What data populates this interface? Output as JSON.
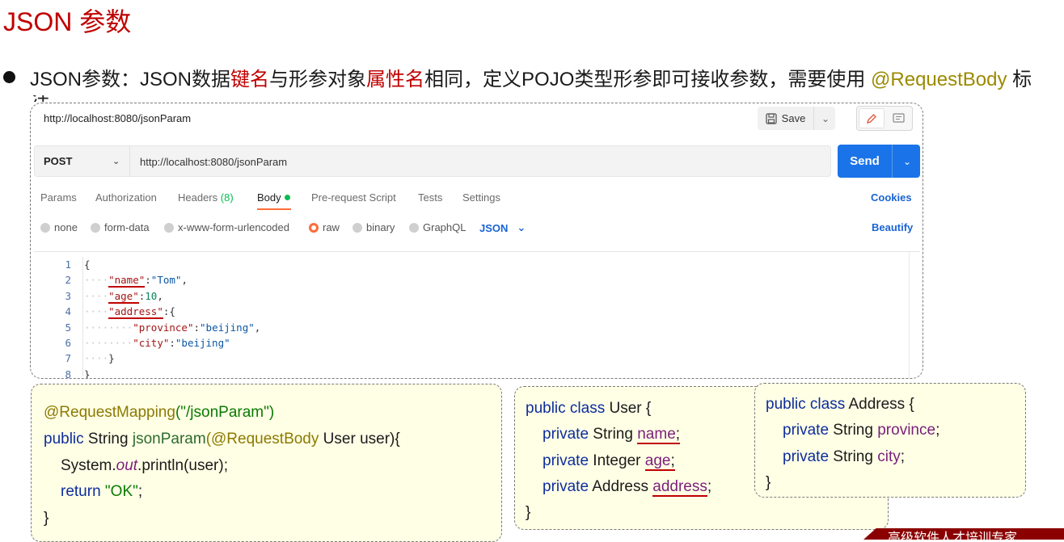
{
  "slide": {
    "title": "JSON 参数",
    "bullet": {
      "p1": "JSON参数：JSON数据",
      "r1": "键名",
      "p2": "与形参对象",
      "r2": "属性名",
      "p3": "相同，定义POJO类型形参即可接收参数，需要使用 ",
      "annotation": "@RequestBody",
      "p4": " 标",
      "tail": "注"
    },
    "footer_banner": "高级软件人才培训专家"
  },
  "postman": {
    "tab_title": "http://localhost:8080/jsonParam",
    "save_label": "Save",
    "method": "POST",
    "url": "http://localhost:8080/jsonParam",
    "send_label": "Send",
    "tabs": [
      {
        "label": "Params"
      },
      {
        "label": "Authorization"
      },
      {
        "label": "Headers",
        "count": "(8)"
      },
      {
        "label": "Body"
      },
      {
        "label": "Pre-request Script"
      },
      {
        "label": "Tests"
      },
      {
        "label": "Settings"
      }
    ],
    "cookies_label": "Cookies",
    "body_options": [
      "none",
      "form-data",
      "x-www-form-urlencoded",
      "raw",
      "binary",
      "GraphQL"
    ],
    "body_format": "JSON",
    "beautify_label": "Beautify",
    "line_numbers": [
      "1",
      "2",
      "3",
      "4",
      "5",
      "6",
      "7",
      "8"
    ],
    "code": {
      "open": "{",
      "name_key": "\"name\"",
      "name_val": "\"Tom\"",
      "age_key": "\"age\"",
      "age_val": "10",
      "address_key": "\"address\"",
      "province_key": "\"province\"",
      "province_val": "\"beijing\"",
      "city_key": "\"city\"",
      "city_val": "\"beijing\"",
      "inner_close": "}",
      "close": "}"
    }
  },
  "controller": {
    "mapping_ann": "@RequestMapping",
    "mapping_path": "(\"/jsonParam\")",
    "kw_public": "public",
    "ret_type": " String ",
    "method_name": "jsonParam",
    "param_ann": "(@RequestBody",
    "param_rest": " User user){",
    "sys": "System.",
    "out": "out",
    "println": ".println(user);",
    "kw_return": "return",
    "ok": "\"OK\"",
    "semi": ";",
    "close": "}"
  },
  "user_class": {
    "decl_kw": "public class",
    "decl_name": " User {",
    "kw_private": "private",
    "f1_type": " String ",
    "f1_name": "name",
    "f2_type": " Integer ",
    "f2_name": "age",
    "f3_type": " Address ",
    "f3_name": "address",
    "semi": ";",
    "close": "}"
  },
  "address_class": {
    "decl_kw": "public class",
    "decl_name": " Address {",
    "kw_private": "private",
    "f1_type": " String ",
    "f1_name": "province",
    "f2_type": " String ",
    "f2_name": "city",
    "semi": ";",
    "close": "}"
  }
}
